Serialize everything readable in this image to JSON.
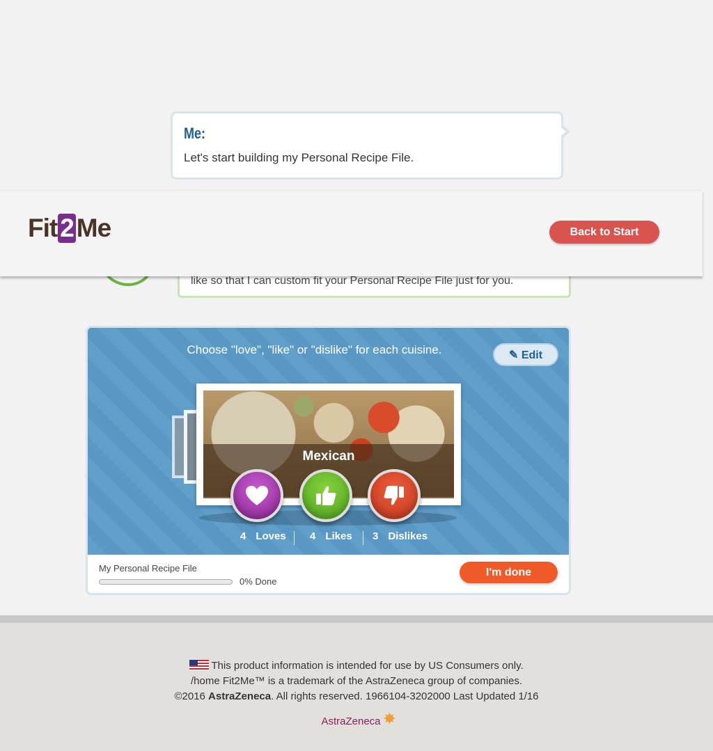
{
  "chat": {
    "speaker": "Me:",
    "message": "Let's start building my Personal Recipe File.",
    "partial_message": "like so that I can custom fit your Personal Recipe File just for you."
  },
  "header": {
    "logo_part1": "Fit",
    "logo_part2": "2",
    "logo_part3": "Me",
    "back_label": "Back to Start"
  },
  "card": {
    "instruction": "Choose \"love\", \"like\" or \"dislike\" for each cuisine.",
    "edit_label": "Edit",
    "cuisine": "Mexican",
    "counts": [
      {
        "num": "4",
        "label": "Loves"
      },
      {
        "num": "4",
        "label": "Likes"
      },
      {
        "num": "3",
        "label": "Dislikes"
      }
    ],
    "progress_label": "My Personal Recipe File",
    "progress_value": 0,
    "progress_text": "0% Done",
    "done_label": "I'm done",
    "colors": {
      "love": "#9b2fa3",
      "like": "#5db325",
      "dislike": "#d9452a",
      "accent": "#f05a28"
    }
  },
  "footer": {
    "line1": "This product information is intended for use by US Consumers only.",
    "line2": "/home Fit2Me™ is a trademark of the AstraZeneca group of companies.",
    "line3_pre": "©2016 ",
    "line3_brand": "AstraZeneca",
    "line3_post": ". All rights reserved. 1966104-3202000 Last Updated 1/16",
    "brand_logo": "AstraZeneca"
  }
}
